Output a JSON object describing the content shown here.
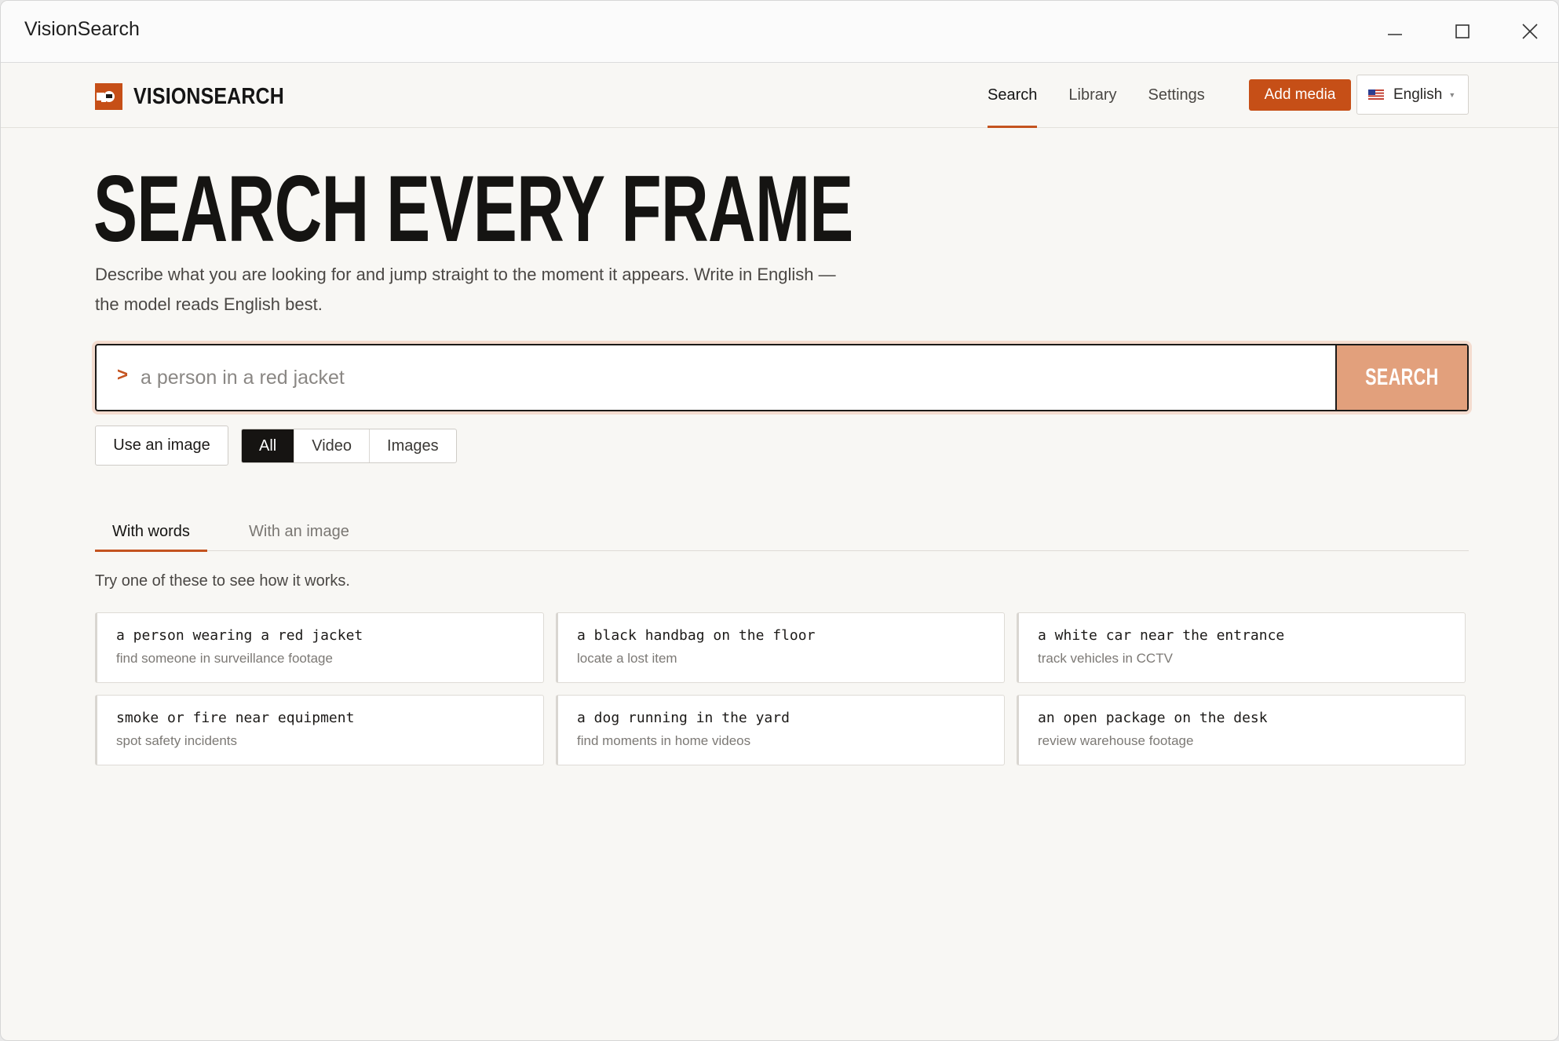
{
  "window": {
    "title": "VisionSearch"
  },
  "brand": {
    "name": "VISIONSEARCH",
    "accent": "#c64f17"
  },
  "nav": {
    "links": [
      {
        "label": "Search",
        "active": true
      },
      {
        "label": "Library",
        "active": false
      },
      {
        "label": "Settings",
        "active": false
      }
    ],
    "add_media": "Add media",
    "language": {
      "flag": "us-flag-icon",
      "label": "English"
    }
  },
  "hero": {
    "title": "SEARCH EVERY FRAME",
    "subtitle": "Describe what you are looking for and jump straight to the moment it appears. Write in English — the model reads English best."
  },
  "search": {
    "prompt_symbol": ">",
    "placeholder": "a person in a red jacket",
    "value": "",
    "button": "SEARCH"
  },
  "filters": {
    "use_image": "Use an image",
    "types": [
      {
        "label": "All",
        "active": true
      },
      {
        "label": "Video",
        "active": false
      },
      {
        "label": "Images",
        "active": false
      }
    ]
  },
  "mode_tabs": [
    {
      "label": "With words",
      "active": true
    },
    {
      "label": "With an image",
      "active": false
    }
  ],
  "hint": "Try one of these to see how it works.",
  "examples": [
    {
      "query": "a person wearing a red jacket",
      "desc": "find someone in surveillance footage"
    },
    {
      "query": "a black handbag on the floor",
      "desc": "locate a lost item"
    },
    {
      "query": "a white car near the entrance",
      "desc": "track vehicles in CCTV"
    },
    {
      "query": "smoke or fire near equipment",
      "desc": "spot safety incidents"
    },
    {
      "query": "a dog running in the yard",
      "desc": "find moments in home videos"
    },
    {
      "query": "an open package on the desk",
      "desc": "review warehouse footage"
    }
  ]
}
